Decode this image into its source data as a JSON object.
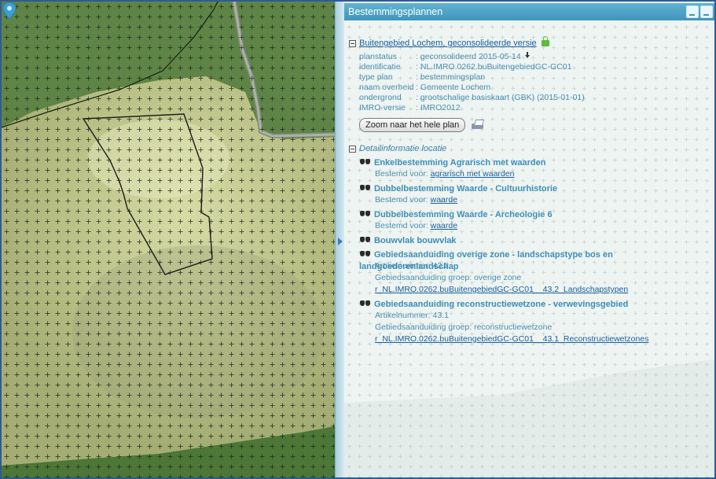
{
  "panel": {
    "title": "Bestemmingsplannen"
  },
  "plan": {
    "title": "Buitengebied Lochem, geconsolideerde versie",
    "properties": [
      {
        "key": "planstatus",
        "value": ": geconsolideerd 2015-05-14"
      },
      {
        "key": "identificatie",
        "value": ": NL.IMRO.0262.buBuitengebiedGC-GC01"
      },
      {
        "key": "type plan",
        "value": ": bestemmingsplan"
      },
      {
        "key": "naam overheid",
        "value": ": Gemeente Lochem"
      },
      {
        "key": "ondergrond",
        "value": ": grootschalige basiskaart (GBK) (2015-01-01)"
      },
      {
        "key": "IMRO-versie",
        "value": ": IMRO2012"
      }
    ],
    "zoom_button": "Zoom naar het hele plan"
  },
  "detail": {
    "title": "Detailinformatie locatie",
    "items": [
      {
        "head": "Enkelbestemming Agrarisch met waarden",
        "l1_label": "Bestemd voor: ",
        "l1_link": "agrarisch met waarden"
      },
      {
        "head": "Dubbelbestemming Waarde - Cultuurhistorie",
        "l1_label": "Bestemd voor: ",
        "l1_link": "waarde"
      },
      {
        "head": "Dubbelbestemming Waarde - Archeologie 6",
        "l1_label": "Bestemd voor: ",
        "l1_link": "waarde"
      },
      {
        "head": "Bouwvlak bouwvlak"
      },
      {
        "head": "Gebiedsaanduiding overige zone - landschapstype bos en landgoederenlandschap",
        "l1": "Artikelnummer: 43.2",
        "l2": "Gebiedsaanduiding groep: overige zone",
        "link": "r_NL.IMRO.0262.buBuitengebiedGC-GC01__43.2_Landschapstypen"
      },
      {
        "head": "Gebiedsaanduiding reconstructiewetzone - verwevingsgebied",
        "l1": "Artikelnummer: 43.1",
        "l2": "Gebiedsaanduiding groep: reconstructiewetzone",
        "link": "r_NL.IMRO.0262.buBuitengebiedGC-GC01__43.1_Reconstructiewetzones"
      }
    ]
  },
  "icons": {
    "collapse": "minus-box-icon",
    "lock": "lock-icon",
    "download": "download-icon",
    "printer": "printer-icon",
    "binoculars": "binoculars-icon",
    "location_pin": "map-pin-icon"
  },
  "colors": {
    "header": "#4aa3c8",
    "link": "#1a5fa0",
    "text": "#4a8eb2"
  }
}
